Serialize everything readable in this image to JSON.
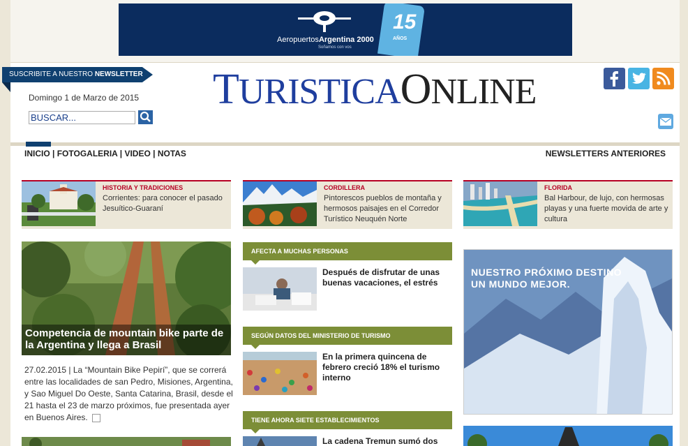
{
  "banner": {
    "brand_light": "Aeropuertos",
    "brand_bold": "Argentina 2000",
    "tagline": "Soñamos con vos",
    "seal_number": "15",
    "seal_text": "AÑOS"
  },
  "newsletter": {
    "label_light": "SUSCRIBITE A NUESTRO",
    "label_bold": "NEWSLETTER"
  },
  "date": "Domingo 1 de Marzo de 2015",
  "search": {
    "value": "BUSCAR..."
  },
  "logo": {
    "part1_first": "T",
    "part1_rest": "URISTICA",
    "part2_first": "O",
    "part2_rest": "NLINE"
  },
  "social": [
    "facebook-icon",
    "twitter-icon",
    "rss-icon",
    "mail-icon"
  ],
  "nav": {
    "items": [
      "INICIO",
      "FOTOGALERIA",
      "VIDEO",
      "NOTAS"
    ],
    "separator": "|",
    "right": "NEWSLETTERS ANTERIORES"
  },
  "top_cards": [
    {
      "category": "HISTORIA Y TRADICIONES",
      "text": "Corrientes: para conocer el pasado Jesuítico-Guaraní"
    },
    {
      "category": "CORDILLERA",
      "text": "Pintorescos pueblos de montaña y hermosos paisajes en el Corredor Turístico Neuquén Norte"
    },
    {
      "category": "FLORIDA",
      "text": "Bal Harbour, de lujo, con hermosas playas y una fuerte movida de arte y cultura"
    }
  ],
  "feature": {
    "caption": "Competencia de mountain bike parte de la Argentina y llega a Brasil",
    "date": "27.02.2015",
    "separator": "|",
    "text": "La “Mountain Bike Pepirí”, que se correrá entre las localidades de san Pedro, Misiones, Argentina, y Sao Miguel Do Oeste, Santa Catarina, Brasil, desde el 21 hasta el 23 de marzo próximos, fue presentada ayer en Buenos Aires."
  },
  "articles": [
    {
      "section": "AFECTA A MUCHAS PERSONAS",
      "title": "Después de disfrutar de unas buenas vacaciones, el estrés"
    },
    {
      "section": "SEGÚN DATOS DEL MINISTERIO DE TURISMO",
      "title": "En la primera quincena de febrero creció 18% el turismo interno"
    },
    {
      "section": "TIENE AHORA SIETE ESTABLECIMIENTOS",
      "title": "La cadena Tremun sumó dos"
    }
  ],
  "ad": {
    "line1": "NUESTRO PRÓXIMO DESTINO",
    "line2": "UN MUNDO MEJOR."
  }
}
